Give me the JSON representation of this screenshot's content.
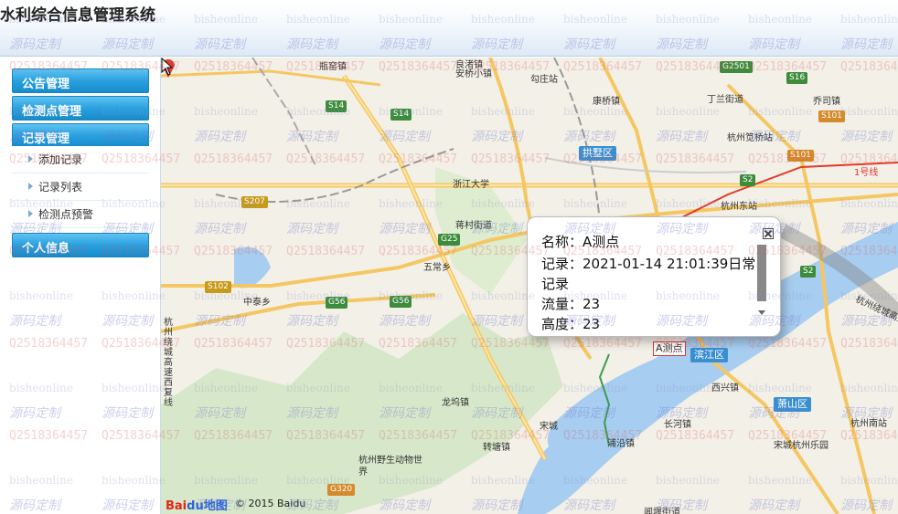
{
  "header": {
    "title": "水利综合信息管理系统"
  },
  "sidebar": {
    "sections": [
      {
        "label": "公告管理"
      },
      {
        "label": "检测点管理"
      },
      {
        "label": "记录管理"
      },
      {
        "label": "个人信息"
      }
    ],
    "record_items": [
      {
        "label": "添加记录"
      },
      {
        "label": "记录列表"
      },
      {
        "label": "检测点预警"
      }
    ]
  },
  "map": {
    "places": [
      "瓶窑镇",
      "良渚镇",
      "安桥小镇",
      "勾庄站",
      "康桥镇",
      "丁兰街道",
      "乔司镇",
      "杭州笕桥站",
      "浙江大学",
      "杭州东站",
      "蒋村街道",
      "五常乡",
      "中泰乡",
      "龙坞镇",
      "转塘镇",
      "宋城",
      "长河镇",
      "浦沿镇",
      "西兴镇",
      "杭州南站",
      "杭州野生动物世界",
      "宋城杭州乐园",
      "闻堰街道",
      "杭州绕城高速",
      "1号线",
      "杭州绕城高速西复线"
    ],
    "districts": [
      "拱墅区",
      "滨江区",
      "萧山区"
    ],
    "highways": [
      "S14",
      "S14",
      "S207",
      "G25",
      "S102",
      "G56",
      "G56",
      "G2501",
      "S16",
      "S101",
      "S101",
      "S2",
      "S2",
      "G320"
    ],
    "marker_label": "A测点",
    "logo_part1": "Bai",
    "logo_part2": "du地图",
    "copyright": "© 2015 Baidu"
  },
  "popup": {
    "name_line": "名称：A测点",
    "record_line": "记录：2021-01-14 21:01:39日常",
    "record_line2": "记录",
    "flow_line": "流量：23",
    "height_line": "高度：23"
  },
  "watermark": {
    "site": "bisheonline",
    "custom": "源码定制",
    "qq": "Q2518364457"
  },
  "colors": {
    "menu_blue": "#2aa0df",
    "district_blue": "#3a8fd0",
    "marker_red": "#e03a2f"
  }
}
